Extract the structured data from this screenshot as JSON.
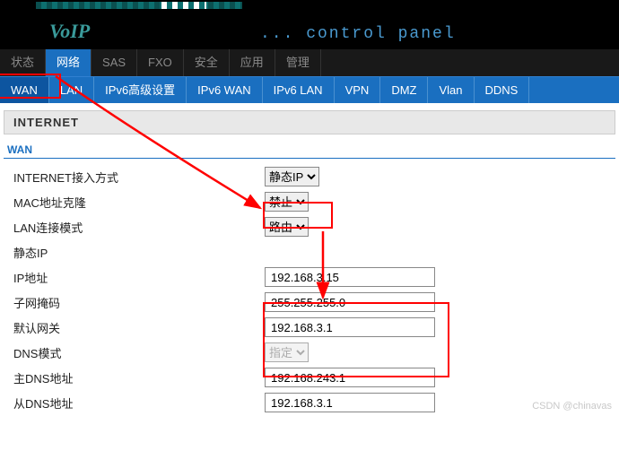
{
  "header": {
    "brand": "VoIP",
    "subtitle": "... control panel"
  },
  "tabs1": {
    "items": [
      "状态",
      "网络",
      "SAS",
      "FXO",
      "安全",
      "应用",
      "管理"
    ],
    "active_index": 1
  },
  "tabs2": {
    "items": [
      "WAN",
      "LAN",
      "IPv6高级设置",
      "IPv6 WAN",
      "IPv6 LAN",
      "VPN",
      "DMZ",
      "Vlan",
      "DDNS"
    ],
    "active_index": 0
  },
  "section_title": "INTERNET",
  "fieldset_label": "WAN",
  "rows": {
    "access_mode_label": "INTERNET接入方式",
    "access_mode_value": "静态IP",
    "mac_clone_label": "MAC地址克隆",
    "mac_clone_value": "禁止",
    "lan_mode_label": "LAN连接模式",
    "lan_mode_value": "路由",
    "static_ip_label": "静态IP",
    "ip_label": "IP地址",
    "ip_value": "192.168.3.15",
    "mask_label": "子网掩码",
    "mask_value": "255.255.255.0",
    "gw_label": "默认网关",
    "gw_value": "192.168.3.1",
    "dns_mode_label": "DNS模式",
    "dns_mode_value": "指定",
    "dns1_label": "主DNS地址",
    "dns1_value": "192.168.243.1",
    "dns2_label": "从DNS地址",
    "dns2_value": "192.168.3.1"
  },
  "watermark": "CSDN @chinavas"
}
